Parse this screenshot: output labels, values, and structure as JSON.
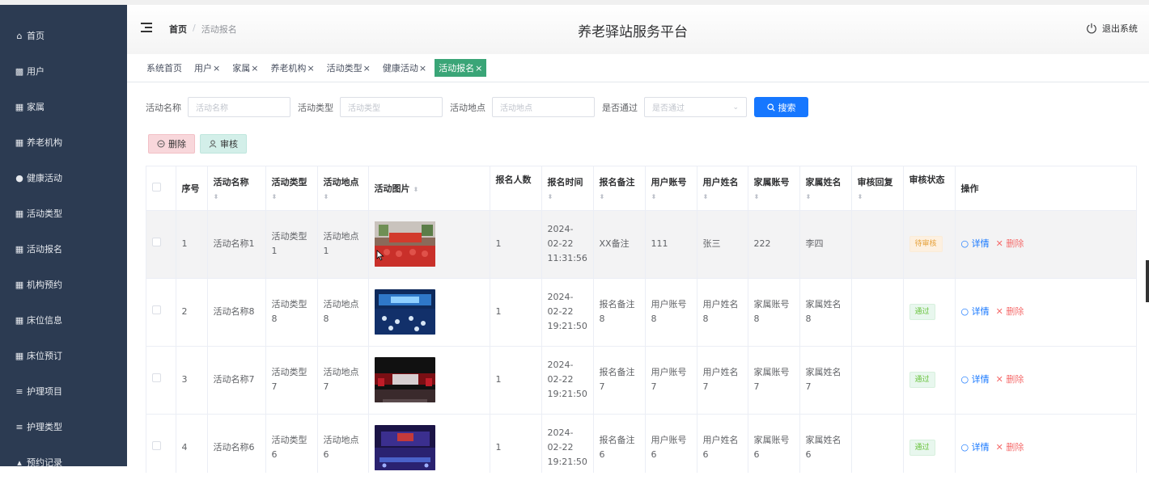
{
  "sidebar": {
    "items": [
      {
        "label": "首页",
        "icon": "home-icon",
        "glyph": "⌂"
      },
      {
        "label": "用户",
        "icon": "chart-icon",
        "glyph": "▩"
      },
      {
        "label": "家属",
        "icon": "grid-icon",
        "glyph": "▦"
      },
      {
        "label": "养老机构",
        "icon": "grid-icon",
        "glyph": "▦"
      },
      {
        "label": "健康活动",
        "icon": "bulb-icon",
        "glyph": "●"
      },
      {
        "label": "活动类型",
        "icon": "grid-icon",
        "glyph": "▦"
      },
      {
        "label": "活动报名",
        "icon": "grid-icon",
        "glyph": "▦"
      },
      {
        "label": "机构预约",
        "icon": "table-icon",
        "glyph": "▦"
      },
      {
        "label": "床位信息",
        "icon": "grid-icon",
        "glyph": "▦"
      },
      {
        "label": "床位预订",
        "icon": "grid-icon",
        "glyph": "▦"
      },
      {
        "label": "护理项目",
        "icon": "list-icon",
        "glyph": "≡"
      },
      {
        "label": "护理类型",
        "icon": "list-icon",
        "glyph": "≡"
      },
      {
        "label": "预约记录",
        "icon": "thumb-icon",
        "glyph": "▴"
      }
    ]
  },
  "header": {
    "breadcrumb_home": "首页",
    "breadcrumb_sep": "/",
    "breadcrumb_current": "活动报名",
    "title": "养老驿站服务平台",
    "logout_label": "退出系统"
  },
  "tabs": [
    {
      "label": "系统首页",
      "closable": false
    },
    {
      "label": "用户",
      "closable": true
    },
    {
      "label": "家属",
      "closable": true
    },
    {
      "label": "养老机构",
      "closable": true
    },
    {
      "label": "活动类型",
      "closable": true
    },
    {
      "label": "健康活动",
      "closable": true
    },
    {
      "label": "活动报名",
      "closable": true,
      "active": true
    }
  ],
  "search": {
    "fields": [
      {
        "label": "活动名称",
        "placeholder": "活动名称"
      },
      {
        "label": "活动类型",
        "placeholder": "活动类型"
      },
      {
        "label": "活动地点",
        "placeholder": "活动地点"
      },
      {
        "label": "是否通过",
        "placeholder": "是否通过"
      }
    ],
    "button_label": "搜索"
  },
  "actions": {
    "delete_label": "删除",
    "audit_label": "审核"
  },
  "table": {
    "columns": [
      "序号",
      "活动名称",
      "活动类型",
      "活动地点",
      "活动图片",
      "报名人数",
      "报名时间",
      "报名备注",
      "用户账号",
      "用户姓名",
      "家属账号",
      "家属姓名",
      "审核回复",
      "审核状态",
      "操作"
    ],
    "rows": [
      {
        "no": "1",
        "name": "活动名称1",
        "type": "活动类型1",
        "place": "活动地点1",
        "image": "outdoor-red-event",
        "count": "1",
        "time": "2024-02-22 11:31:56",
        "remark": "XX备注",
        "account": "111",
        "username": "张三",
        "family_account": "222",
        "family_name": "李四",
        "reply": "",
        "status": "待审核",
        "status_kind": "pending"
      },
      {
        "no": "2",
        "name": "活动名称8",
        "type": "活动类型8",
        "place": "活动地点8",
        "image": "blue-hall-event",
        "count": "1",
        "time": "2024-02-22 19:21:50",
        "remark": "报名备注8",
        "account": "用户账号8",
        "username": "用户姓名8",
        "family_account": "家属账号8",
        "family_name": "家属姓名8",
        "reply": "",
        "status": "通过",
        "status_kind": "pass"
      },
      {
        "no": "3",
        "name": "活动名称7",
        "type": "活动类型7",
        "place": "活动地点7",
        "image": "stage-screen-event",
        "count": "1",
        "time": "2024-02-22 19:21:50",
        "remark": "报名备注7",
        "account": "用户账号7",
        "username": "用户姓名7",
        "family_account": "家属账号7",
        "family_name": "家属姓名7",
        "reply": "",
        "status": "通过",
        "status_kind": "pass"
      },
      {
        "no": "4",
        "name": "活动名称6",
        "type": "活动类型6",
        "place": "活动地点6",
        "image": "purple-stage-event",
        "count": "1",
        "time": "2024-02-22 19:21:50",
        "remark": "报名备注6",
        "account": "用户账号6",
        "username": "用户姓名6",
        "family_account": "家属账号6",
        "family_name": "家属姓名6",
        "reply": "",
        "status": "通过",
        "status_kind": "pass"
      }
    ],
    "detail_label": "详情",
    "delete_label": "删除"
  },
  "colors": {
    "sidebar_bg": "#2c3b52",
    "active_tab": "#3aa577",
    "primary": "#1677ff",
    "danger": "#f56c6c"
  }
}
